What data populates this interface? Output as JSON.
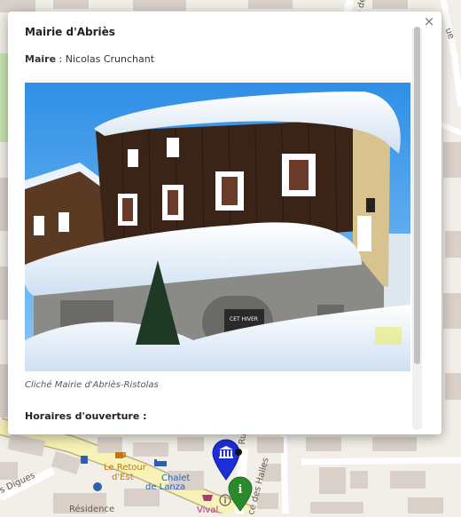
{
  "popup": {
    "title": "Mairie d'Abriès",
    "mayor_label": "Maire",
    "mayor_separator": " : ",
    "mayor_name": "Nicolas Crunchant",
    "photo_caption": "Cliché Mairie d'Abriès-Ristolas",
    "hours_title": "Horaires d'ouverture :",
    "close_glyph": "×",
    "photo_sign_text": "CET HIVER"
  },
  "map": {
    "labels": {
      "le_retour": "Le Retour",
      "d_est": "d'Est",
      "chalet": "Chalet",
      "de_lanza": "de Lanza",
      "residence": "Résidence",
      "vival": "Vival",
      "digues": "s Digues",
      "halles": "ce des Halles",
      "street_right_top": "Rue de la L",
      "street_vertical": "Ru",
      "edge_left": "ue"
    },
    "markers": {
      "town_hall": "town-hall-marker",
      "info": "information-marker"
    }
  },
  "colors": {
    "marker_blue": "#1a2fd6",
    "marker_green": "#2a8a2a",
    "road_yellow": "#f7f2b8",
    "building": "#d9d0c9"
  }
}
